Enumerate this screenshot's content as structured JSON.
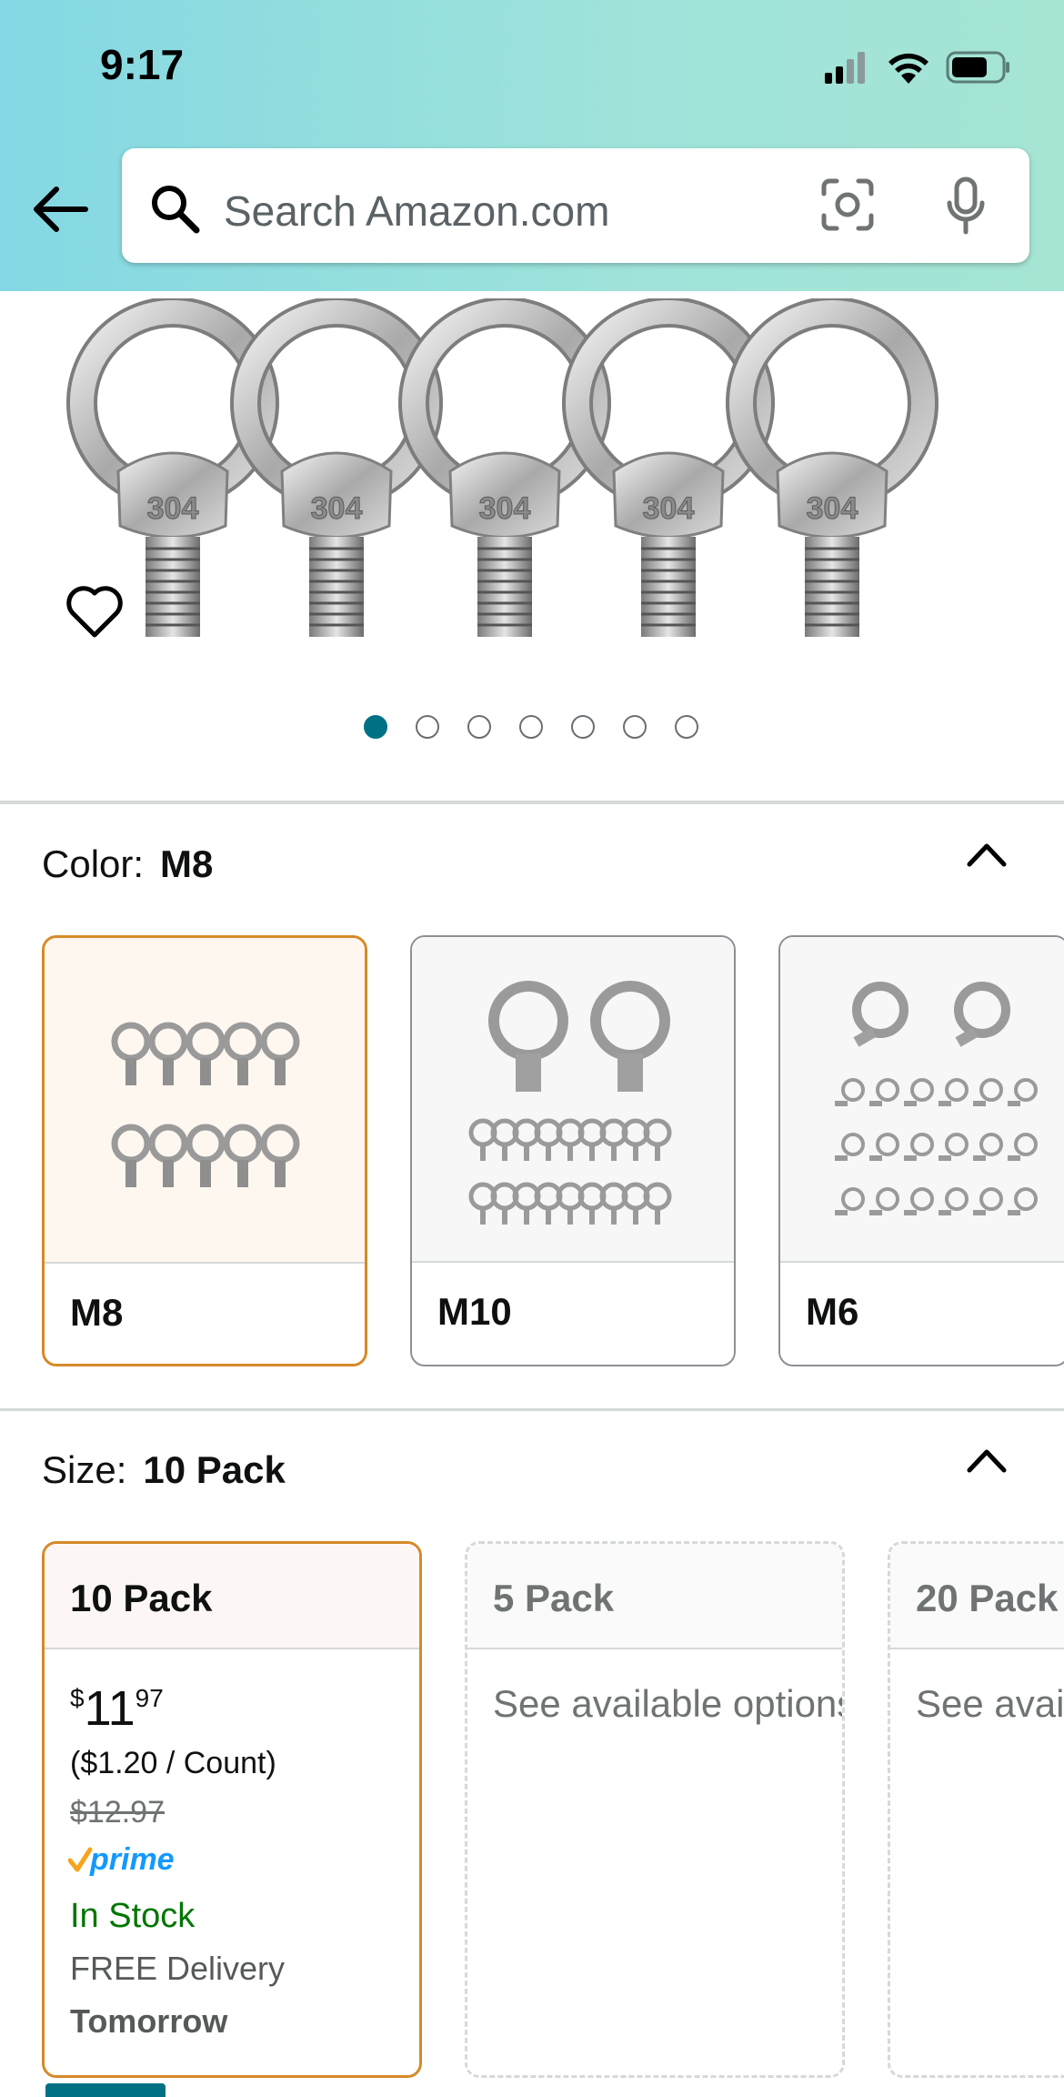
{
  "status_bar": {
    "time": "9:17"
  },
  "search": {
    "placeholder": "Search Amazon.com"
  },
  "carousel": {
    "total": 7,
    "active_index": 0
  },
  "color_option": {
    "label": "Color:",
    "selected_value": "M8",
    "swatches": [
      {
        "label": "M8",
        "selected": true
      },
      {
        "label": "M10",
        "selected": false
      },
      {
        "label": "M6",
        "selected": false
      }
    ]
  },
  "size_option": {
    "label": "Size:",
    "selected_value": "10 Pack",
    "cards": [
      {
        "title": "10 Pack",
        "selected": true,
        "price_symbol": "$",
        "price_whole": "11",
        "price_fraction": "97",
        "unit_price": "($1.20 / Count)",
        "list_price": "$12.97",
        "stock": "In Stock",
        "delivery": "FREE Delivery",
        "delivery_day": "Tomorrow"
      },
      {
        "title": "5 Pack",
        "selected": false,
        "message": "See available options"
      },
      {
        "title": "20 Pack",
        "selected": false,
        "message": "See available options"
      }
    ]
  },
  "colors": {
    "accent_teal": "#007185",
    "selected_border": "#d68a28",
    "in_stock_green": "#007600",
    "prime_blue": "#1399ff"
  },
  "icons": [
    "back-arrow-icon",
    "search-icon",
    "camera-icon",
    "mic-icon",
    "heart-icon",
    "chevron-up-icon",
    "prime-logo",
    "signal-icon",
    "wifi-icon",
    "battery-icon"
  ]
}
